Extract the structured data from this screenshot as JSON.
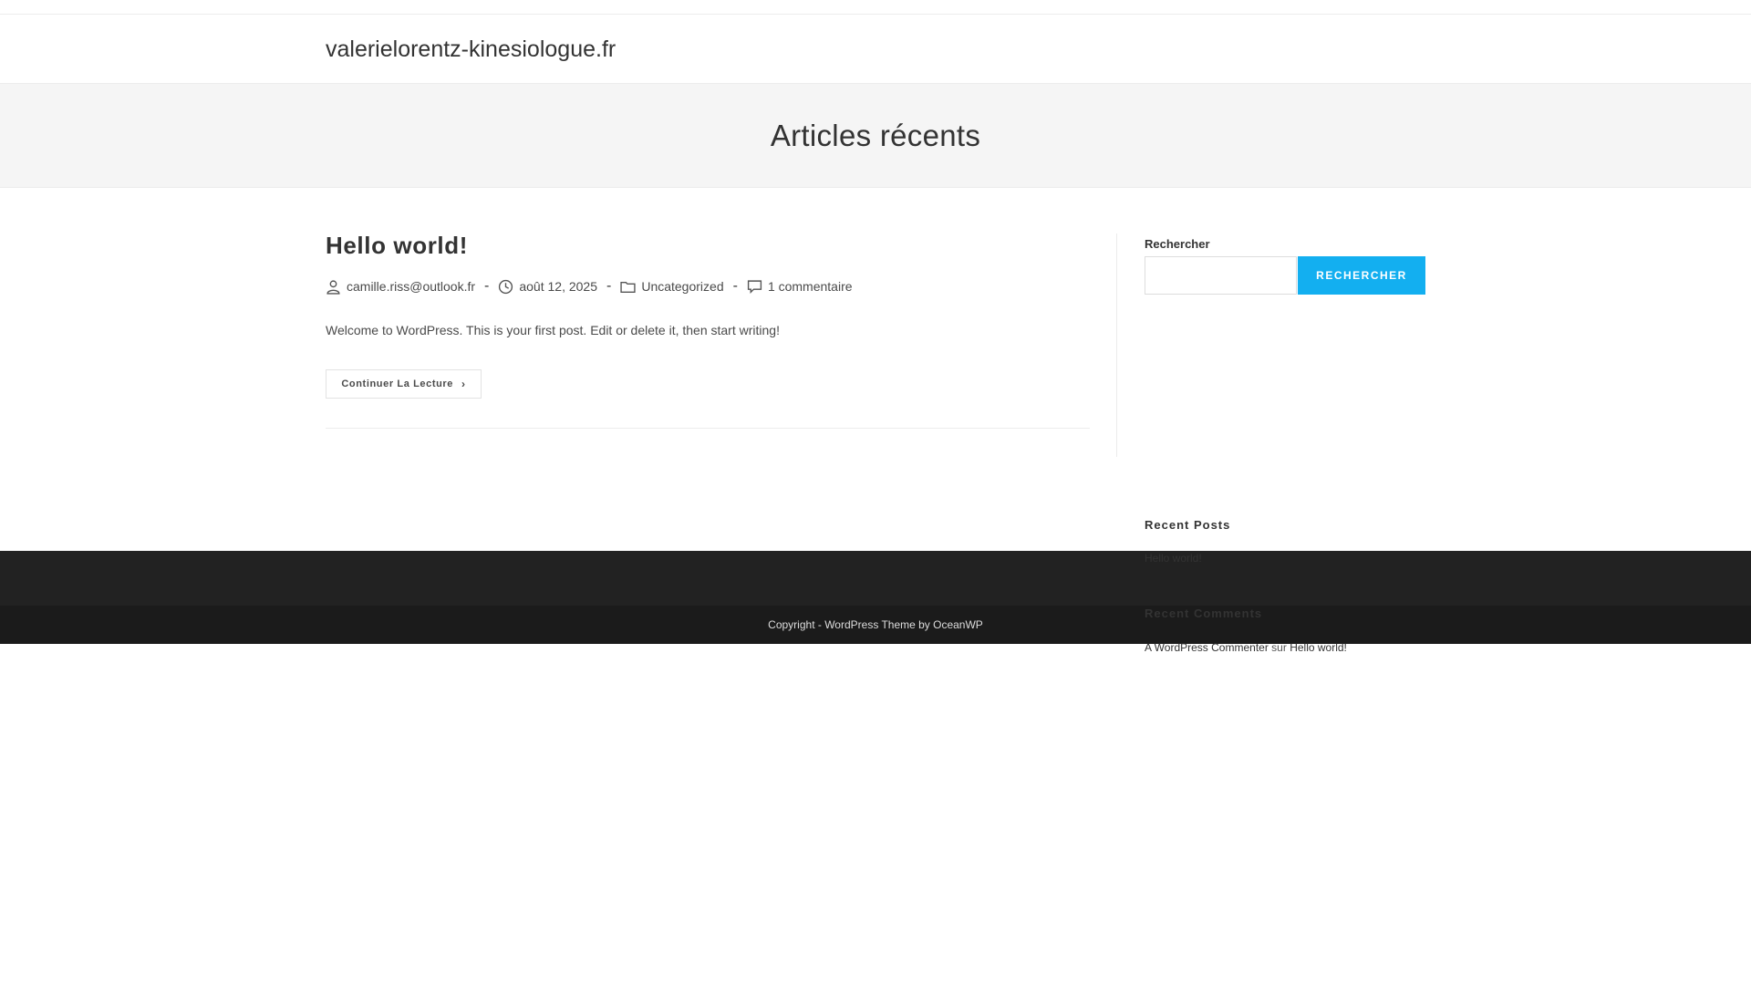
{
  "header": {
    "site_title": "valerielorentz-kinesiologue.fr"
  },
  "page_header": {
    "title": "Articles récents"
  },
  "post": {
    "title": "Hello world!",
    "meta": {
      "author": "camille.riss@outlook.fr",
      "date": "août 12, 2025",
      "category": "Uncategorized",
      "comments": "1 commentaire",
      "separator": "-",
      "icons": [
        "user-icon",
        "clock-icon",
        "folder-icon",
        "comment-icon"
      ]
    },
    "excerpt": "Welcome to WordPress. This is your first post. Edit or delete it, then start writing!",
    "read_more_label": "Continuer La Lecture"
  },
  "sidebar": {
    "search": {
      "label": "Rechercher",
      "value": "",
      "button_label": "RECHERCHER"
    },
    "recent_posts": {
      "title": "Recent Posts",
      "items": [
        "Hello world!"
      ]
    },
    "recent_comments": {
      "title": "Recent Comments",
      "items": [
        {
          "author": "A WordPress Commenter",
          "connector": "sur",
          "post": "Hello world!"
        }
      ]
    }
  },
  "footer": {
    "copyright": "Copyright - WordPress Theme by OceanWP"
  },
  "colors": {
    "accent": "#13aff0",
    "footer_bg": "#222222",
    "footer_bottom_bg": "#1b1b1b",
    "page_header_bg": "#f5f5f5"
  }
}
